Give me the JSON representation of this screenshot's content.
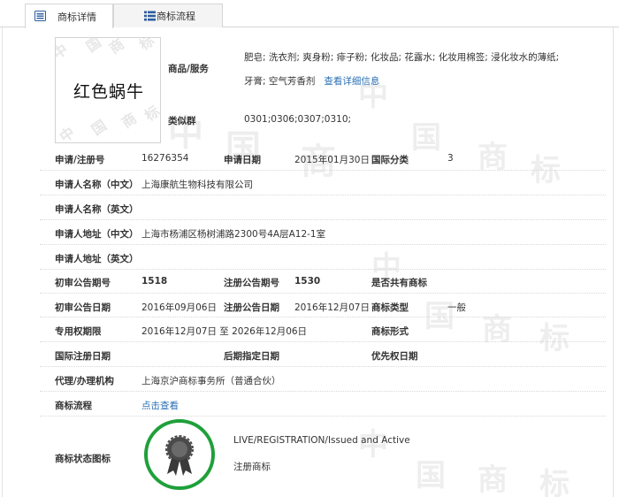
{
  "tabs": {
    "details": "商标详情",
    "flow": "商标流程"
  },
  "trademark": {
    "name_image_text": "红色蜗牛",
    "goods_label": "商品/服务",
    "goods_value": "肥皂; 洗衣剂; 爽身粉; 痱子粉; 化妆品; 花露水; 化妆用棉签; 浸化妆水的薄纸; 牙膏; 空气芳香剂",
    "goods_more_link": "查看详细信息",
    "similar_label": "类似群",
    "similar_value": "0301;0306;0307;0310;"
  },
  "rows": {
    "reg_no_label": "申请/注册号",
    "reg_no": "16276354",
    "app_date_label": "申请日期",
    "app_date": "2015年01月30日",
    "intl_class_label": "国际分类",
    "intl_class": "3",
    "applicant_cn_label": "申请人名称（中文）",
    "applicant_cn": "上海康航生物科技有限公司",
    "applicant_en_label": "申请人名称（英文）",
    "address_cn_label": "申请人地址（中文）",
    "address_cn": "上海市杨浦区杨树浦路2300号4A层A12-1室",
    "address_en_label": "申请人地址（英文）",
    "prelim_no_label": "初审公告期号",
    "prelim_no": "1518",
    "reg_ann_no_label": "注册公告期号",
    "reg_ann_no": "1530",
    "shared_label": "是否共有商标",
    "prelim_date_label": "初审公告日期",
    "prelim_date": "2016年09月06日",
    "reg_ann_date_label": "注册公告日期",
    "reg_ann_date": "2016年12月07日",
    "tm_type_label": "商标类型",
    "tm_type": "一般",
    "exclusive_label": "专用权期限",
    "exclusive_value": "2016年12月07日 至 2026年12月06日",
    "tm_form_label": "商标形式",
    "intl_reg_date_label": "国际注册日期",
    "later_date_label": "后期指定日期",
    "priority_date_label": "优先权日期",
    "agent_label": "代理/办理机构",
    "agent_value": "上海京沪商标事务所（普通合伙）",
    "flow_label": "商标流程",
    "flow_link": "点击查看",
    "status_label": "商标状态图标",
    "status_en": "LIVE/REGISTRATION/Issued and Active",
    "status_cn": "注册商标"
  },
  "colors": {
    "link": "#2a6fb5",
    "badge_green": "#1fa03a",
    "tab_icon": "#2d5d9f"
  },
  "watermark": {
    "chars": [
      "中",
      "国",
      "商",
      "标"
    ]
  }
}
